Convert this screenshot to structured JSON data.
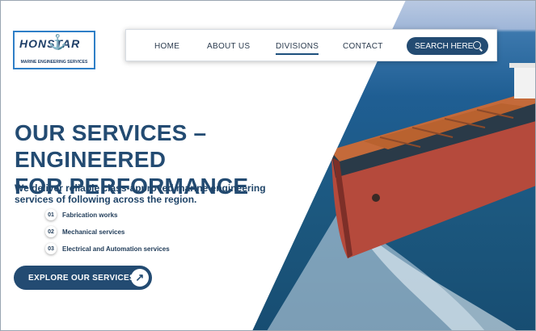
{
  "logo": {
    "word": "HONSTAR",
    "tagline": "MARINE ENGINEERING SERVICES"
  },
  "nav": {
    "items": [
      {
        "label": "HOME"
      },
      {
        "label": "ABOUT US"
      },
      {
        "label": "DIVISIONS",
        "active": true
      },
      {
        "label": "CONTACT"
      }
    ],
    "search_label": "SEARCH HERE"
  },
  "hero": {
    "title_line1": "OUR SERVICES – ENGINEERED",
    "title_line2": "FOR PERFORMANCE",
    "description": "We deliver reliable class-approved marine engineering services of following across the region.",
    "services": [
      {
        "number": "01",
        "label": "Fabrication works"
      },
      {
        "number": "02",
        "label": "Mechanical services"
      },
      {
        "number": "03",
        "label": "Electrical and Automation services"
      }
    ],
    "cta_label": "EXPLORE OUR SERVICES"
  },
  "colors": {
    "primary": "#234b72",
    "accent": "#2f7fc7",
    "hull": "#b54a3c",
    "deck": "#c46a3a"
  }
}
